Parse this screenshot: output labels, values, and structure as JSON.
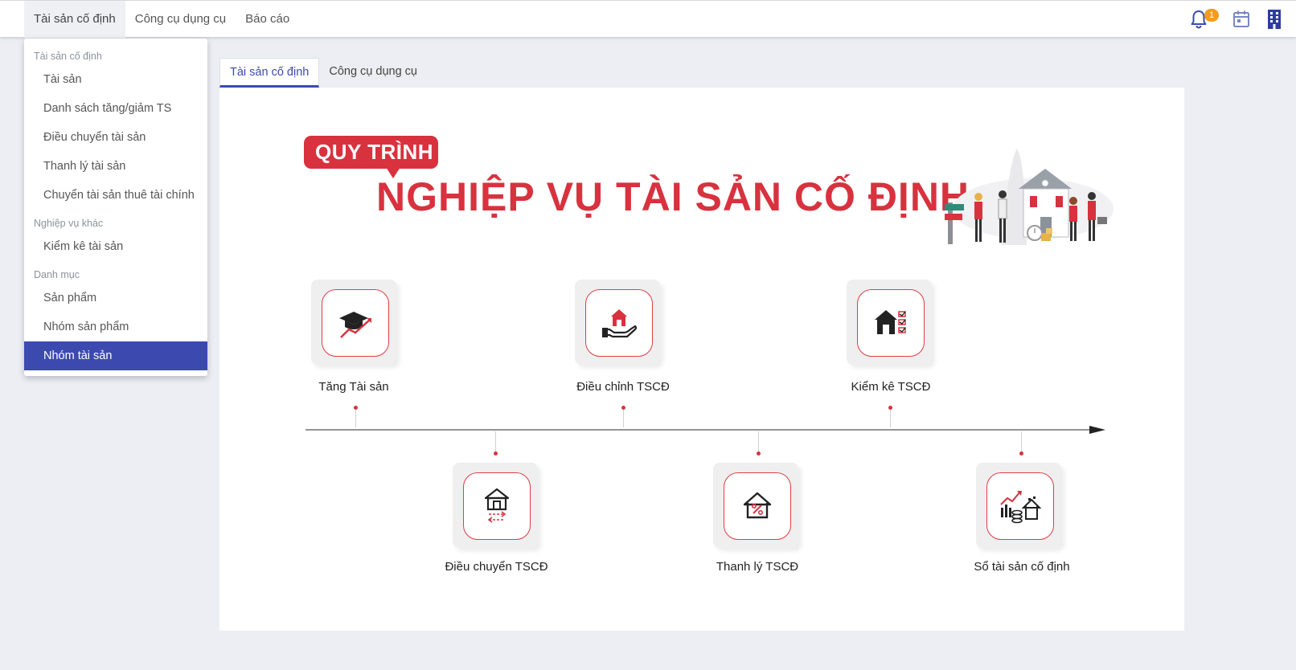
{
  "topnav": {
    "items": [
      {
        "label": "Tài sản cố định",
        "active": true
      },
      {
        "label": "Công cụ dụng cụ",
        "active": false
      },
      {
        "label": "Báo cáo",
        "active": false
      }
    ],
    "notification_count": "1",
    "icons": [
      "bell-icon",
      "calendar-icon",
      "building-icon"
    ]
  },
  "dropdown": {
    "groups": [
      {
        "title": "Tài sản cố định",
        "items": [
          "Tài sản",
          "Danh sách tăng/giảm TS",
          "Điều chuyển tài sản",
          "Thanh lý tài sản",
          "Chuyển tài sản thuê tài chính"
        ]
      },
      {
        "title": "Nghiệp vụ khác",
        "items": [
          "Kiểm kê tài sản"
        ]
      },
      {
        "title": "Danh mục",
        "items": [
          "Sản phẩm",
          "Nhóm sản phẩm",
          "Nhóm tài sản"
        ]
      }
    ],
    "selected": "Nhóm tài sản"
  },
  "tabs": [
    {
      "label": "Tài sản cố định",
      "active": true
    },
    {
      "label": "Công cụ dụng cụ",
      "active": false
    }
  ],
  "banner": {
    "pill_text": "QUY TRÌNH",
    "title": "NGHIỆP VỤ TÀI SẢN CỐ ĐỊNH"
  },
  "steps": [
    {
      "label": "Tăng Tài sản",
      "icon": "graduation-growth-icon"
    },
    {
      "label": "Điều chuyển TSCĐ",
      "icon": "house-transfer-icon"
    },
    {
      "label": "Điều chỉnh TSCĐ",
      "icon": "house-hand-icon"
    },
    {
      "label": "Thanh lý TSCĐ",
      "icon": "house-percent-icon"
    },
    {
      "label": "Kiểm kê TSCĐ",
      "icon": "house-checklist-icon"
    },
    {
      "label": "Sổ tài sản cố định",
      "icon": "asset-ledger-icon"
    }
  ],
  "colors": {
    "accent": "#3c4ab0",
    "brand_red": "#d8323f",
    "badge": "#f39c1f"
  }
}
